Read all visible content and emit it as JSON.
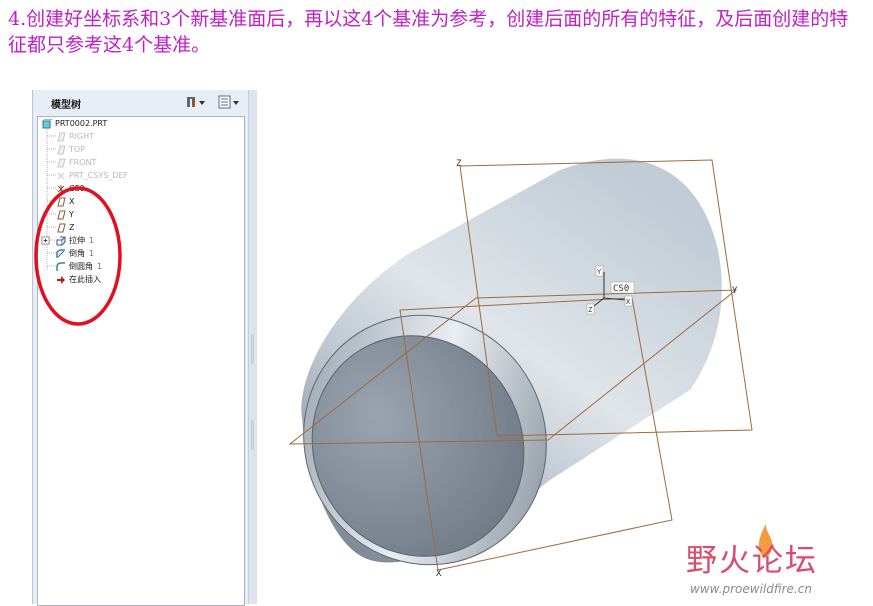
{
  "instruction": "4.创建好坐标系和3个新基准面后，再以这4个基准为参考，创建后面的所有的特征，及后面创建的特征都只参考这4个基准。",
  "model_tree": {
    "title": "模型树",
    "settings_icon": "tree-settings-icon",
    "view_icon": "tree-view-icon",
    "items": [
      {
        "label": "PRT0002.PRT",
        "icon": "part-icon",
        "num": ""
      },
      {
        "label": "RIGHT",
        "icon": "datum-plane-icon",
        "num": ""
      },
      {
        "label": "TOP",
        "icon": "datum-plane-icon",
        "num": ""
      },
      {
        "label": "FRONT",
        "icon": "datum-plane-icon",
        "num": ""
      },
      {
        "label": "PRT_CSYS_DEF",
        "icon": "csys-icon",
        "num": ""
      },
      {
        "label": "CS0",
        "icon": "csys-icon",
        "num": ""
      },
      {
        "label": "X",
        "icon": "datum-plane-icon",
        "num": ""
      },
      {
        "label": "Y",
        "icon": "datum-plane-icon",
        "num": ""
      },
      {
        "label": "Z",
        "icon": "datum-plane-icon",
        "num": ""
      },
      {
        "label": "拉伸",
        "icon": "extrude-icon",
        "num": "1"
      },
      {
        "label": "倒角",
        "icon": "chamfer-icon",
        "num": "1"
      },
      {
        "label": "倒圆角",
        "icon": "round-icon",
        "num": "1"
      },
      {
        "label": "在此插入",
        "icon": "insert-here-arrow-icon",
        "num": ""
      }
    ]
  },
  "viewport": {
    "csys_label": "CS0",
    "plane_labels": [
      "Z",
      "Y",
      "X"
    ],
    "axis_labels": [
      "Y",
      "Z",
      "X"
    ]
  },
  "colors": {
    "instruction": "#c020c8",
    "highlight_circle": "#e01020",
    "datum": "#a06a3a"
  },
  "watermark": {
    "name": "野火论坛",
    "url": "www.proewildfire.cn"
  }
}
